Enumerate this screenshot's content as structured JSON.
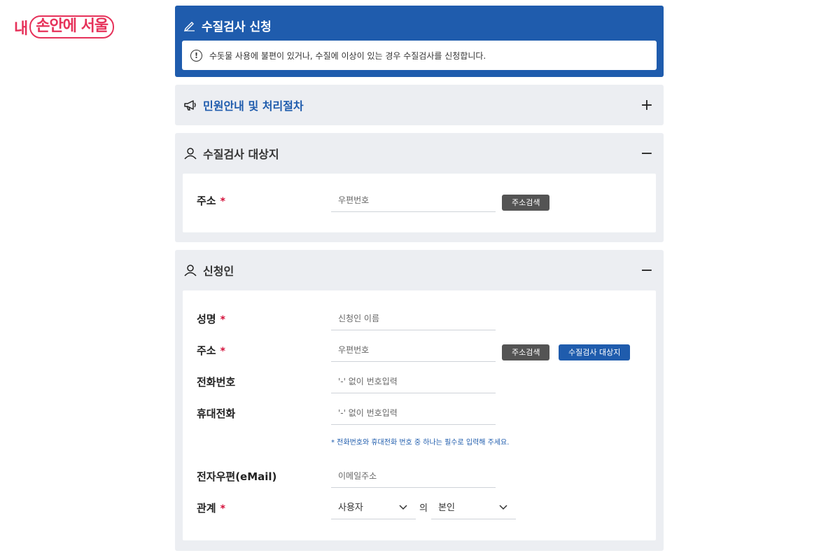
{
  "logo": {
    "part1": "내",
    "part2": "손안에 서울"
  },
  "hero": {
    "title": "수질검사 신청",
    "notice": "수돗물 사용에 불편이 있거나, 수질에 이상이 있는 경우 수질검사를 신청합니다."
  },
  "guide": {
    "title": "민원안내 및 처리절차",
    "toggle": "+"
  },
  "target": {
    "title": "수질검사 대상지",
    "toggle": "−",
    "address_label": "주소",
    "required": "*",
    "postal_placeholder": "우편번호",
    "search_btn": "주소검색"
  },
  "applicant": {
    "title": "신청인",
    "toggle": "−",
    "required": "*",
    "name_label": "성명",
    "name_placeholder": "신청인 이름",
    "address_label": "주소",
    "postal_placeholder": "우편번호",
    "search_btn": "주소검색",
    "same_btn": "수질검사 대상지",
    "phone_label": "전화번호",
    "phone_placeholder": "'-' 없이 번호입력",
    "mobile_label": "휴대전화",
    "mobile_placeholder": "'-' 없이 번호입력",
    "phone_note": "*  전화번호와 휴대전화 번호 중 하나는 필수로 입력해 주세요.",
    "email_label": "전자우편(eMail)",
    "email_placeholder": "이메일주소",
    "relation_label": "관계",
    "relation_left": "사용자",
    "relation_of": "의",
    "relation_right": "본인"
  }
}
